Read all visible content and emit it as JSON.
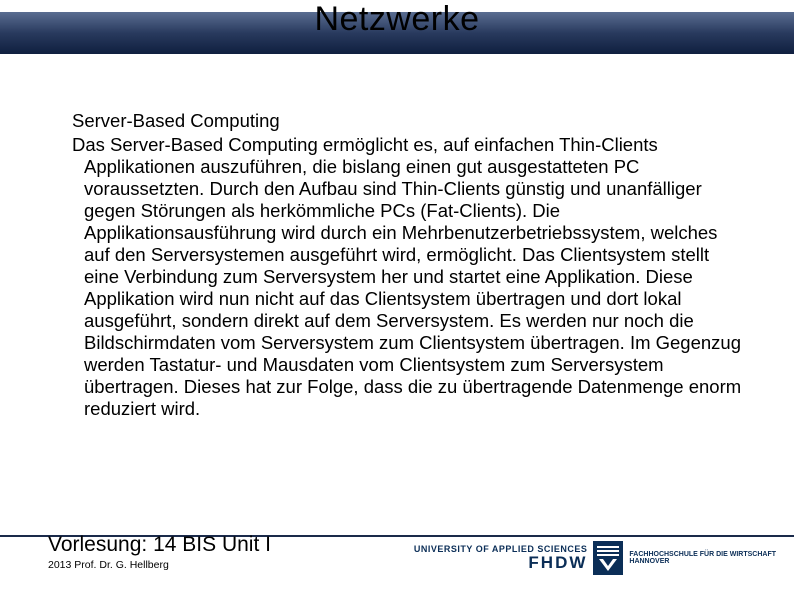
{
  "title": "Netzwerke",
  "content": {
    "subheading": "Server-Based Computing",
    "body_first": "Das Server-Based Computing ermöglicht es, auf einfachen Thin-Clients",
    "body_rest": "Applikationen auszuführen, die bislang einen gut ausgestatteten PC voraussetzten. Durch den Aufbau sind Thin-Clients günstig und unanfälliger gegen Störungen als herkömmliche PCs (Fat-Clients). Die Applikationsausführung wird durch ein Mehrbenutzerbetriebssystem, welches auf den Serversystemen ausgeführt wird, ermöglicht. Das Clientsystem stellt eine Verbindung zum Serversystem her und startet eine Applikation. Diese Applikation wird nun nicht auf das Clientsystem übertragen und dort lokal ausgeführt, sondern direkt auf dem Serversystem. Es werden nur noch die Bildschirmdaten vom Serversystem zum Clientsystem übertragen. Im Gegenzug werden Tastatur- und Mausdaten vom Clientsystem zum Serversystem übertragen. Dieses hat zur Folge, dass die zu übertragende Datenmenge enorm reduziert wird."
  },
  "footer": {
    "lecture_label": "Vorlesung:",
    "lecture_value": " 14 BIS Unit I",
    "copyright": "2013 Prof. Dr. G. Hellberg"
  },
  "logo": {
    "left_line1": "UNIVERSITY OF APPLIED SCIENCES",
    "left_line2": "FHDW",
    "right_line1": "FACHHOCHSCHULE FÜR DIE WIRTSCHAFT",
    "right_line2": "HANNOVER"
  }
}
